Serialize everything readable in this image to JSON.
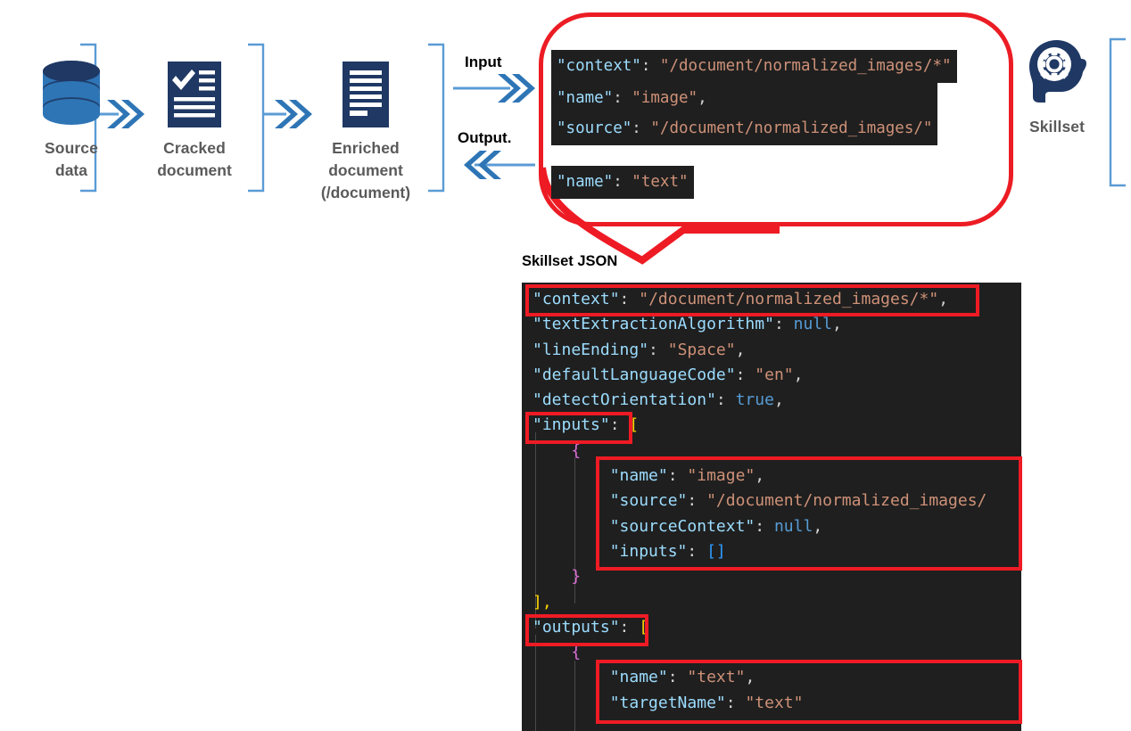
{
  "diagram": {
    "nodes": [
      {
        "id": "source-data",
        "label": "Source",
        "sub": "data",
        "sub2": "",
        "icon": "database-cylinder-icon"
      },
      {
        "id": "cracked-document",
        "label": "Cracked",
        "sub": "document",
        "sub2": "",
        "icon": "checklist-document-icon"
      },
      {
        "id": "enriched-document",
        "label": "Enriched",
        "sub": "document",
        "sub2": "(/document)",
        "icon": "document-lines-icon"
      },
      {
        "id": "skillset",
        "label": "Skillset",
        "sub": "",
        "sub2": "",
        "icon": "brain-gear-icon"
      }
    ],
    "flow_labels": {
      "input": "Input",
      "output": "Output."
    },
    "accent_color": "#4a90d9",
    "icon_color": "#1f3864",
    "label_color": "#5a5a5a",
    "highlight_color": "#ee1b24"
  },
  "callout": {
    "chips": [
      {
        "id": "context-chip",
        "lines": [
          {
            "key": "\"context\"",
            "sep": ": ",
            "value": "\"/document/normalized_images/*\"",
            "tail": ""
          }
        ]
      },
      {
        "id": "input-chip",
        "lines": [
          {
            "key": "\"name\"",
            "sep": ": ",
            "value": "\"image\"",
            "tail": ","
          },
          {
            "key": "\"source\"",
            "sep": ": ",
            "value": "\"/document/normalized_images/\"",
            "tail": ""
          }
        ]
      },
      {
        "id": "output-chip",
        "lines": [
          {
            "key": "\"name\"",
            "sep": ": ",
            "value": "\"text\"",
            "tail": ""
          }
        ]
      }
    ]
  },
  "json_caption": "Skillset JSON",
  "code": {
    "context_key": "\"context\"",
    "context_value": "\"/document/normalized_images/*\"",
    "textExtractionAlgorithm_key": "\"textExtractionAlgorithm\"",
    "textExtractionAlgorithm_value": "null",
    "lineEnding_key": "\"lineEnding\"",
    "lineEnding_value": "\"Space\"",
    "defaultLanguageCode_key": "\"defaultLanguageCode\"",
    "defaultLanguageCode_value": "\"en\"",
    "detectOrientation_key": "\"detectOrientation\"",
    "detectOrientation_value": "true",
    "inputs_key": "\"inputs\"",
    "inputs_open": "[",
    "brace_open": "{",
    "in_name_key": "\"name\"",
    "in_name_value": "\"image\"",
    "in_source_key": "\"source\"",
    "in_source_value": "\"/document/normalized_images/",
    "in_sourceContext_key": "\"sourceContext\"",
    "in_sourceContext_value": "null",
    "in_inputs_key": "\"inputs\"",
    "in_inputs_value": "[]",
    "brace_close": "}",
    "inputs_close": "],",
    "outputs_key": "\"outputs\"",
    "outputs_open": "[",
    "out_brace_open": "{",
    "out_name_key": "\"name\"",
    "out_name_value": "\"text\"",
    "out_targetName_key": "\"targetName\"",
    "out_targetName_value": "\"text\"",
    "colon": ": ",
    "comma": ",",
    "colon_only": ":"
  },
  "colors": {
    "code_bg": "#1f1f1f",
    "key": "#9cdcfe",
    "string": "#ce9178",
    "keyword": "#569cd6",
    "bracket_yellow": "#ffd602",
    "bracket_blue": "#2e9bff",
    "brace_magenta": "#da70d6",
    "highlight_red": "#ee1b24"
  }
}
